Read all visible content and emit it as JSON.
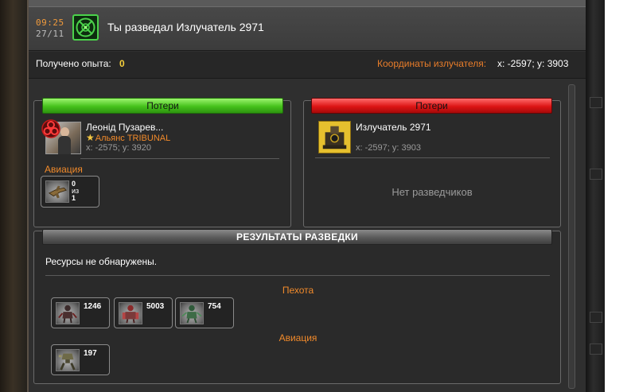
{
  "header": {
    "time": "09:25",
    "date": "27/11",
    "message_icon": "radar-icon",
    "title": "Ты разведал Излучатель 2971"
  },
  "info": {
    "experience_label": "Получено опыта:",
    "experience_value": "0",
    "coords_label": "Координаты излучателя:",
    "coords_value": "x: -2597; y: 3903"
  },
  "attacker": {
    "bar_label": "Потери",
    "bar_color": "#45c21b",
    "name": "Леонід Пузарев...",
    "alliance": "Альянс TRIBUNAL",
    "coords": "x: -2575; y: 3920",
    "section": "Авиация",
    "lost_unit": {
      "icon": "aircraft-icon",
      "lost": "0",
      "of": "из",
      "total": "1"
    }
  },
  "target": {
    "bar_label": "Потери",
    "bar_color": "#dd1515",
    "name": "Излучатель 2971",
    "coords": "x: -2597; y: 3903",
    "empty_text": "Нет разведчиков"
  },
  "results": {
    "title": "РЕЗУЛЬТАТЫ РАЗВЕДКИ",
    "resources_text": "Ресурсы не обнаружены.",
    "infantry_label": "Пехота",
    "infantry": [
      {
        "icon": "infantry-unit-icon",
        "count": "1246"
      },
      {
        "icon": "heavy-infantry-icon",
        "count": "5003"
      },
      {
        "icon": "mutant-unit-icon",
        "count": "754"
      }
    ],
    "aviation_label": "Авиация",
    "aviation": [
      {
        "icon": "mech-walker-icon",
        "count": "197"
      }
    ]
  }
}
